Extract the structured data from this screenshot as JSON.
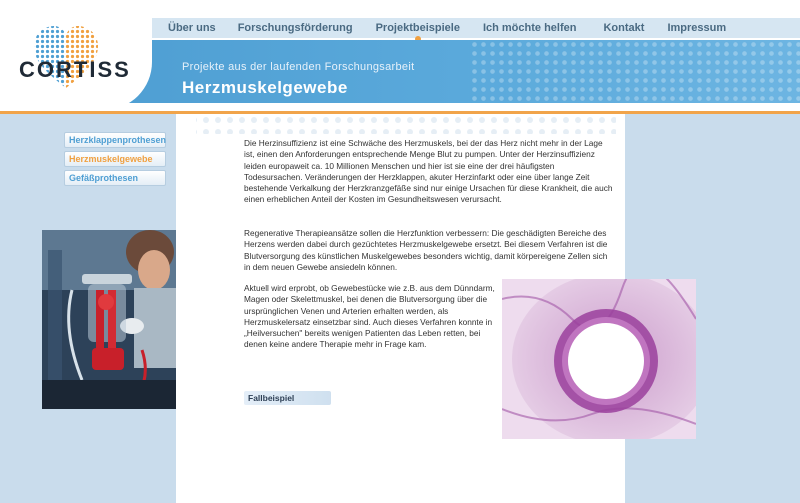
{
  "logo": {
    "text": "CORTISS"
  },
  "nav": {
    "items": [
      {
        "label": "Über uns"
      },
      {
        "label": "Forschungsförderung"
      },
      {
        "label": "Projektbeispiele"
      },
      {
        "label": "Ich möchte helfen"
      },
      {
        "label": "Kontakt"
      },
      {
        "label": "Impressum"
      }
    ],
    "active_index": 2
  },
  "banner": {
    "subtitle": "Projekte aus der laufenden Forschungsarbeit",
    "title": "Herzmuskelgewebe"
  },
  "sidebar": {
    "items": [
      {
        "label": "Herzklappenprothesen"
      },
      {
        "label": "Herzmuskelgewebe"
      },
      {
        "label": "Gefäßprothesen"
      }
    ],
    "active_index": 1
  },
  "content": {
    "paragraphs": [
      "Die Herzinsuffizienz ist eine Schwäche des Herzmuskels, bei der das Herz nicht mehr in der Lage ist, einen den Anforderungen entsprechende Menge Blut zu pumpen. Unter der Herzinsuffizienz leiden europaweit ca. 10 Millionen Menschen und hier ist sie eine der drei häufigsten Todesursachen. Veränderungen der Herzklappen, akuter Herzinfarkt oder eine über lange Zeit bestehende Verkalkung der Herzkranzgefäße sind nur einige Ursachen für diese Krankheit, die auch einen erheblichen Anteil der Kosten im Gesundheitswesen verursacht.",
      "Regenerative Therapieansätze sollen die Herzfunktion verbessern: Die geschädigten Bereiche des Herzens werden dabei durch gezüchtetes Herzmuskelgewebe ersetzt. Bei diesem Verfahren ist die Blutversorgung des künstlichen Muskelgewebes besonders wichtig, damit körpereigene Zellen sich in dem neuen Gewebe ansiedeln können.",
      "Aktuell wird erprobt, ob Gewebestücke wie z.B. aus dem Dünndarm, Magen oder Skelettmuskel, bei denen die Blutversorgung über die ursprünglichen Venen und Arterien erhalten werden, als Herzmuskelersatz einsetzbar sind. Auch dieses Verfahren konnte in „Heilversuchen\" bereits wenigen Patienten das Leben retten, bei denen keine andere Therapie mehr in Frage kam."
    ],
    "case_button": "Fallbeispiel"
  },
  "colors": {
    "banner_blue": "#4f9fd3",
    "nav_bar": "#d6e6f2",
    "accent_orange": "#f0a040",
    "side_column": "#c9dcec"
  },
  "icons": [
    "cortiss-heart-logo",
    "lab-bioreactor-photo",
    "tissue-histology-image"
  ]
}
